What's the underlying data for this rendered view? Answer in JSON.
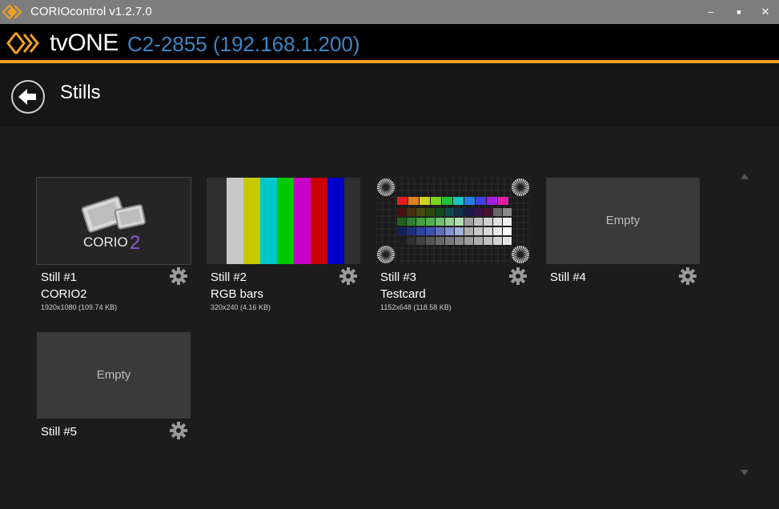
{
  "window": {
    "title": "CORIOcontrol v1.2.7.0",
    "minimize_glyph": "–",
    "maximize_glyph": "■",
    "close_glyph": "✕"
  },
  "brand": {
    "name": "tvONE",
    "device": "C2-2855 (192.168.1.200)"
  },
  "page": {
    "title": "Stills"
  },
  "stills": [
    {
      "name": "Still #1",
      "source": "CORIO2",
      "info": "1920x1080 (109.74 KB)",
      "empty": false
    },
    {
      "name": "Still #2",
      "source": "RGB bars",
      "info": "320x240 (4.16 KB)",
      "empty": false
    },
    {
      "name": "Still #3",
      "source": "Testcard",
      "info": "1152x648 (118.58 KB)",
      "empty": false
    },
    {
      "name": "Still #4",
      "source": "",
      "info": "",
      "empty": true,
      "placeholder": "Empty"
    },
    {
      "name": "Still #5",
      "source": "",
      "info": "",
      "empty": true,
      "placeholder": "Empty"
    }
  ],
  "thumbs": {
    "corio_text": "CORIO",
    "corio_num": "2",
    "color_bars": [
      "#c8c8c8",
      "#c8c800",
      "#00c8c8",
      "#00c800",
      "#c800c8",
      "#c80000",
      "#0000c8"
    ]
  },
  "colors": {
    "accent_orange": "#f0a020",
    "device_blue": "#3a86c8",
    "titlebar": "#7d7d7d"
  }
}
